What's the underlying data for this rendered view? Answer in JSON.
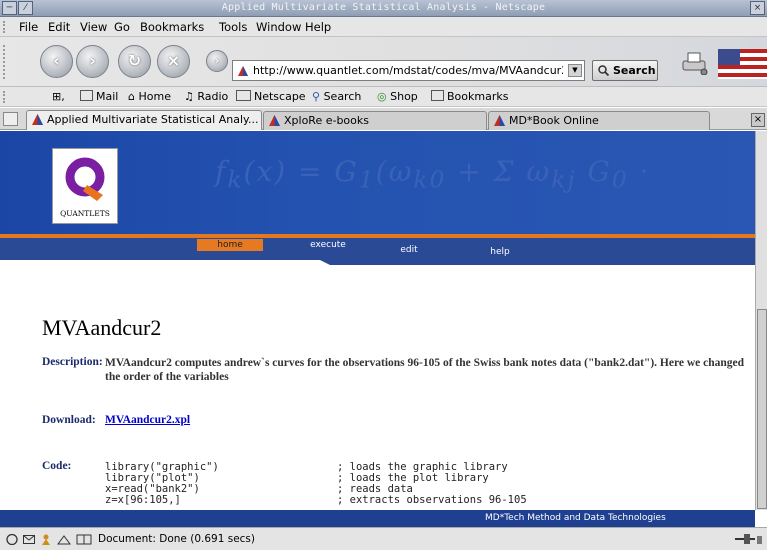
{
  "window": {
    "title": "Applied Multivariate Statistical Analysis - Netscape"
  },
  "menubar": {
    "items": [
      "File",
      "Edit",
      "View",
      "Go",
      "Bookmarks",
      "Tools",
      "Window",
      "Help"
    ]
  },
  "navigation": {
    "url": "http://www.quantlet.com/mdstat/codes/mva/MVAandcur2.html",
    "search_label": "Search"
  },
  "personal_toolbar": {
    "items": [
      "Mail",
      "Home",
      "Radio",
      "Netscape",
      "Search",
      "Shop",
      "Bookmarks"
    ]
  },
  "tabs": [
    {
      "label": "Applied Multivariate Statistical Analy...",
      "active": true
    },
    {
      "label": "XploRe e-books",
      "active": false
    },
    {
      "label": "MD*Book Online",
      "active": false
    }
  ],
  "page": {
    "logo_text": "QUANTLETS",
    "nav": [
      "home",
      "execute",
      "edit",
      "help"
    ],
    "heading": "MVAandcur2",
    "description_label": "Description:",
    "description_text": "MVAandcur2 computes andrew`s curves for the observations 96-105 of the Swiss bank notes data (\"bank2.dat\"). Here we changed the order of the variables",
    "download_label": "Download:",
    "download_link": "MVAandcur2.xpl",
    "code_label": "Code:",
    "code_lines": [
      {
        "code": "library(\"graphic\")",
        "comment": "; loads the graphic library"
      },
      {
        "code": "library(\"plot\")",
        "comment": "; loads the plot library"
      },
      {
        "code": "x=read(\"bank2\")",
        "comment": "; reads data"
      },
      {
        "code": "z=x[96:105,]",
        "comment": "; extracts observations 96-105"
      }
    ],
    "footer": "MD*Tech  Method and Data Technologies"
  },
  "status": {
    "text": "Document: Done (0.691 secs)"
  },
  "colors": {
    "banner_blue": "#2452b0",
    "nav_orange": "#e67a22",
    "heading_label": "#1a2a6c",
    "link": "#0000cc"
  }
}
